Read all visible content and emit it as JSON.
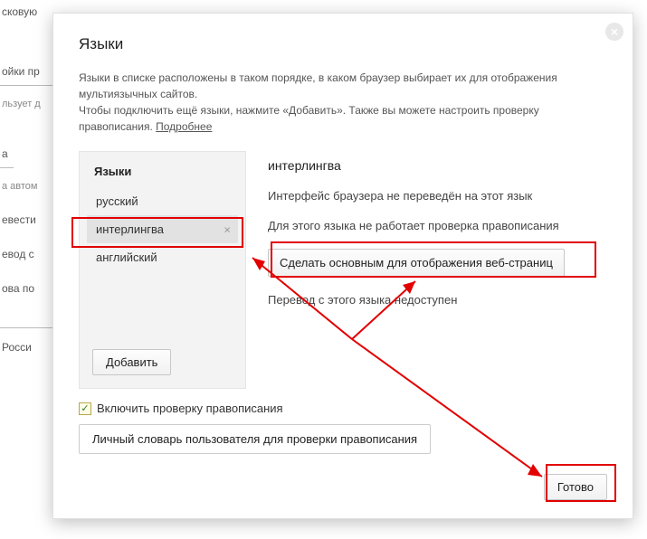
{
  "bg": {
    "items": [
      "сковую",
      "ойки пр",
      "льзует д",
      "а",
      "а автом",
      "евести",
      "евод с",
      "ова по",
      "Росси"
    ]
  },
  "dialog": {
    "title": "Языки",
    "intro1": "Языки в списке расположены в таком порядке, в каком браузер выбирает их для отображения мультиязычных сайтов.",
    "intro2_a": "Чтобы подключить ещё языки, нажмите «Добавить». Также вы можете настроить проверку правописания. ",
    "intro2_link": "Подробнее"
  },
  "langs": {
    "header": "Языки",
    "items": [
      "русский",
      "интерлингва",
      "английский"
    ],
    "selected_index": 1,
    "add_label": "Добавить"
  },
  "detail": {
    "heading": "интерлингва",
    "line1": "Интерфейс браузера не переведён на этот язык",
    "line2": "Для этого языка не работает проверка правописания",
    "primary_btn": "Сделать основным для отображения веб-страниц",
    "line3": "Перевод с этого языка недоступен"
  },
  "below": {
    "checkbox_label": "Включить проверку правописания",
    "checkbox_checked": true,
    "dict_btn": "Личный словарь пользователя для проверки правописания"
  },
  "footer": {
    "done": "Готово"
  },
  "icons": {
    "close": "×",
    "remove": "×",
    "check": "✓"
  }
}
